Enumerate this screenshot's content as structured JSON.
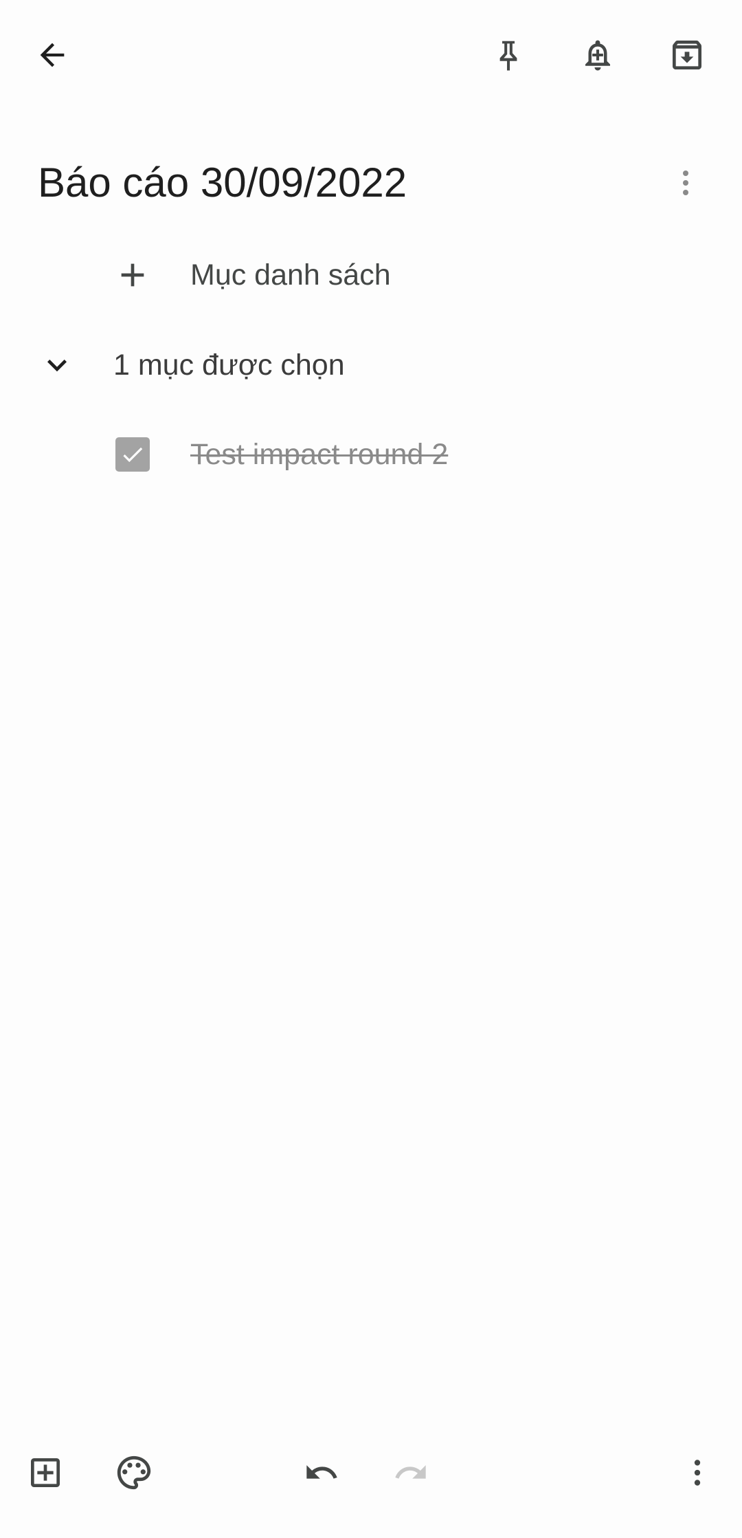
{
  "note": {
    "title": "Báo cáo 30/09/2022",
    "add_item_label": "Mục danh sách",
    "checked_group_label": "1 mục được chọn",
    "checked_items": [
      {
        "text": "Test impact round 2",
        "checked": true
      }
    ]
  },
  "icons": {
    "back": "arrow-back-icon",
    "pin": "pin-icon",
    "reminder": "add-alert-icon",
    "archive": "archive-icon",
    "more": "more-vert-icon",
    "add_item": "plus-icon",
    "collapse": "chevron-down-icon",
    "add_box": "add-box-icon",
    "palette": "palette-icon",
    "undo": "undo-icon",
    "redo": "redo-icon"
  },
  "colors": {
    "background": "#fdfdfd",
    "icon": "#444746",
    "checkbox_checked": "#a3a3a3",
    "disabled": "#c8c8c8"
  }
}
